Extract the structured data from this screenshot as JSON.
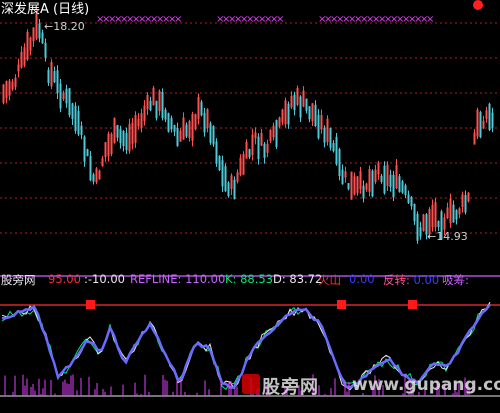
{
  "main": {
    "title": "深发展A (日线)",
    "high_label": "18.20",
    "low_label": "14.93",
    "marker_symbol": "×"
  },
  "indicator": {
    "name": "股旁网",
    "values": [
      {
        "label": "",
        "value": "95.00",
        "color": "#ff3030"
      },
      {
        "label": ":",
        "value": "-10.00",
        "color": "#e8e8e8"
      },
      {
        "label": "REFLINE:",
        "value": "110.00",
        "color": "#c864ff"
      },
      {
        "label": "K:",
        "value": "88.53",
        "color": "#00e676"
      },
      {
        "label": "D:",
        "value": "83.72",
        "color": "#e8e8e8"
      },
      {
        "label": "火山",
        "value": "0.00",
        "color": "#3a3aff"
      },
      {
        "label": "反转:",
        "value": "0.00",
        "color": "#ff5090"
      },
      {
        "label": "吸筹:",
        "value": "",
        "color": "#c864ff"
      }
    ]
  },
  "watermark": {
    "cn": "股旁网",
    "url": "www.gupang.com"
  },
  "colors": {
    "up": "#ff5050",
    "down": "#4ec9d8",
    "grid": "#b02020",
    "magenta": "#e040fb"
  }
}
